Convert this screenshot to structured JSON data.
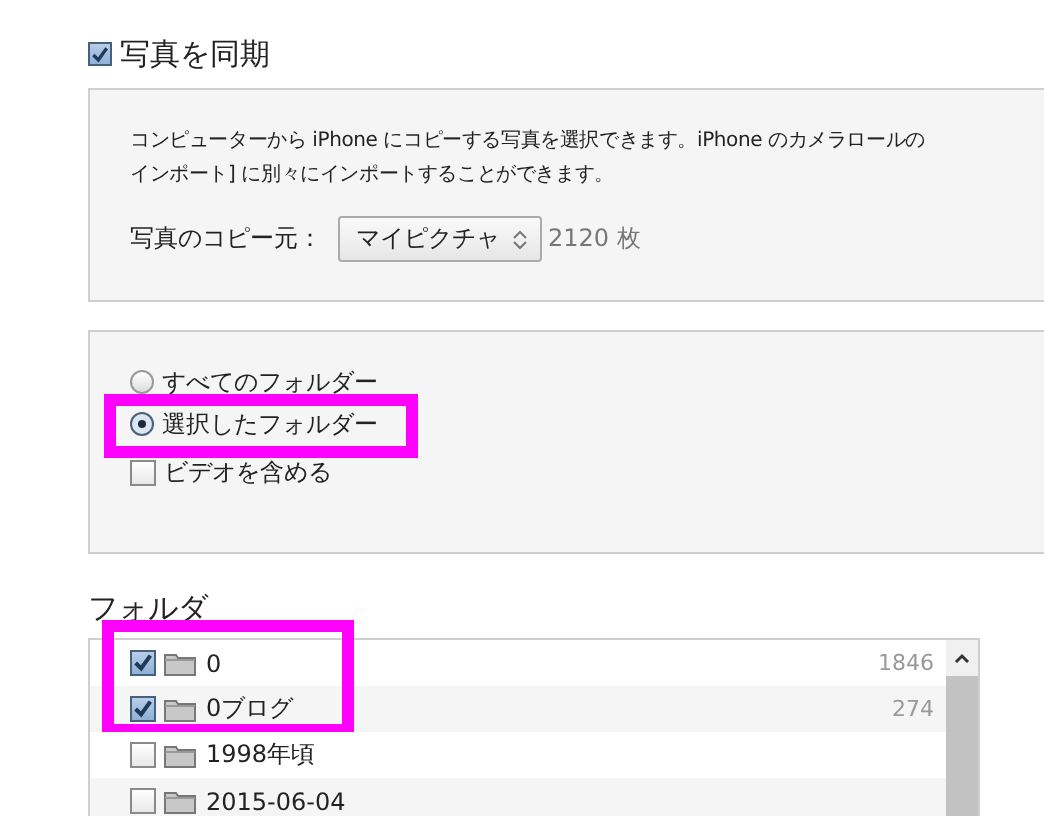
{
  "sync": {
    "label": "写真を同期",
    "checked": true
  },
  "info": {
    "description_lines": [
      "コンピューターから iPhone にコピーする写真を選択できます。iPhone のカメラロールの",
      "インポート] に別々にインポートすることができます。"
    ],
    "source_label": "写真のコピー元：",
    "source_value": "マイピクチャ",
    "count": "2120 枚"
  },
  "options": [
    {
      "kind": "radio",
      "label": "すべてのフォルダー",
      "selected": false,
      "highlighted": false
    },
    {
      "kind": "radio",
      "label": "選択したフォルダー",
      "selected": true,
      "highlighted": true
    },
    {
      "kind": "checkbox",
      "label": "ビデオを含める",
      "checked": false,
      "highlighted": false
    }
  ],
  "folders": {
    "heading": "フォルダ",
    "rows": [
      {
        "name": "0",
        "count": "1846",
        "checked": true,
        "highlighted": true
      },
      {
        "name": "0ブログ",
        "count": "274",
        "checked": true,
        "highlighted": true
      },
      {
        "name": "1998年頃",
        "checked": false,
        "highlighted": false
      },
      {
        "name": "2015-06-04",
        "checked": false,
        "highlighted": false
      }
    ]
  }
}
